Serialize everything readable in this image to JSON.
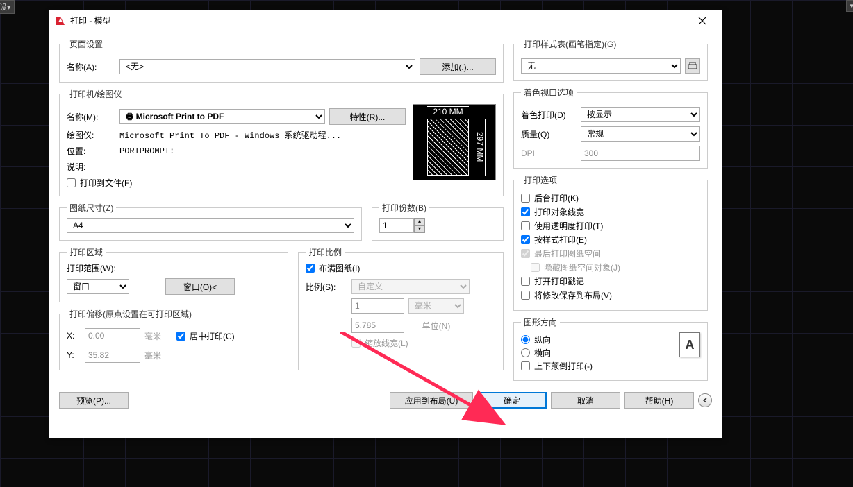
{
  "window": {
    "title": "打印 - 模型"
  },
  "pageSetup": {
    "legend": "页面设置",
    "nameLabel": "名称(A):",
    "nameValue": "<无>",
    "addBtn": "添加(.)..."
  },
  "printer": {
    "legend": "打印机/绘图仪",
    "nameLabel": "名称(M):",
    "nameValue": "Microsoft Print to PDF",
    "propsBtn": "特性(R)...",
    "plotterLabel": "绘图仪:",
    "plotterValue": "Microsoft Print To PDF - Windows 系统驱动程...",
    "locationLabel": "位置:",
    "locationValue": "PORTPROMPT:",
    "descLabel": "说明:",
    "plotToFile": "打印到文件(F)",
    "dimTop": "210 MM",
    "dimRight": "297 MM"
  },
  "paperSize": {
    "legend": "图纸尺寸(Z)",
    "value": "A4"
  },
  "copies": {
    "legend": "打印份数(B)",
    "value": "1"
  },
  "plotArea": {
    "legend": "打印区域",
    "rangeLabel": "打印范围(W):",
    "rangeValue": "窗口",
    "windowBtn": "窗口(O)<"
  },
  "plotScale": {
    "legend": "打印比例",
    "fitToPaper": "布满图纸(I)",
    "scaleLabel": "比例(S):",
    "scaleValue": "自定义",
    "unitValue": "1",
    "unitSel": "毫米",
    "eq": "=",
    "drawingValue": "5.785",
    "drawingUnit": "单位(N)",
    "scaleLineweights": "缩放线宽(L)"
  },
  "plotOffset": {
    "legend": "打印偏移(原点设置在可打印区域)",
    "xLabel": "X:",
    "xValue": "0.00",
    "xUnit": "毫米",
    "yLabel": "Y:",
    "yValue": "35.82",
    "yUnit": "毫米",
    "center": "居中打印(C)"
  },
  "plotStyle": {
    "legend": "打印样式表(画笔指定)(G)",
    "value": "无"
  },
  "shaded": {
    "legend": "着色视口选项",
    "shadeLabel": "着色打印(D)",
    "shadeValue": "按显示",
    "qualityLabel": "质量(Q)",
    "qualityValue": "常规",
    "dpiLabel": "DPI",
    "dpiValue": "300"
  },
  "plotOptions": {
    "legend": "打印选项",
    "background": "后台打印(K)",
    "lineweights": "打印对象线宽",
    "transparency": "使用透明度打印(T)",
    "withStyles": "按样式打印(E)",
    "paperspaceLast": "最后打印图纸空间",
    "hidePaperspace": "隐藏图纸空间对象(J)",
    "stampOn": "打开打印戳记",
    "saveChanges": "将修改保存到布局(V)"
  },
  "orientation": {
    "legend": "图形方向",
    "portrait": "纵向",
    "landscape": "横向",
    "upsideDown": "上下颠倒打印(-)",
    "icon": "A"
  },
  "footer": {
    "preview": "预览(P)...",
    "applyToLayout": "应用到布局(U)",
    "ok": "确定",
    "cancel": "取消",
    "help": "帮助(H)"
  }
}
